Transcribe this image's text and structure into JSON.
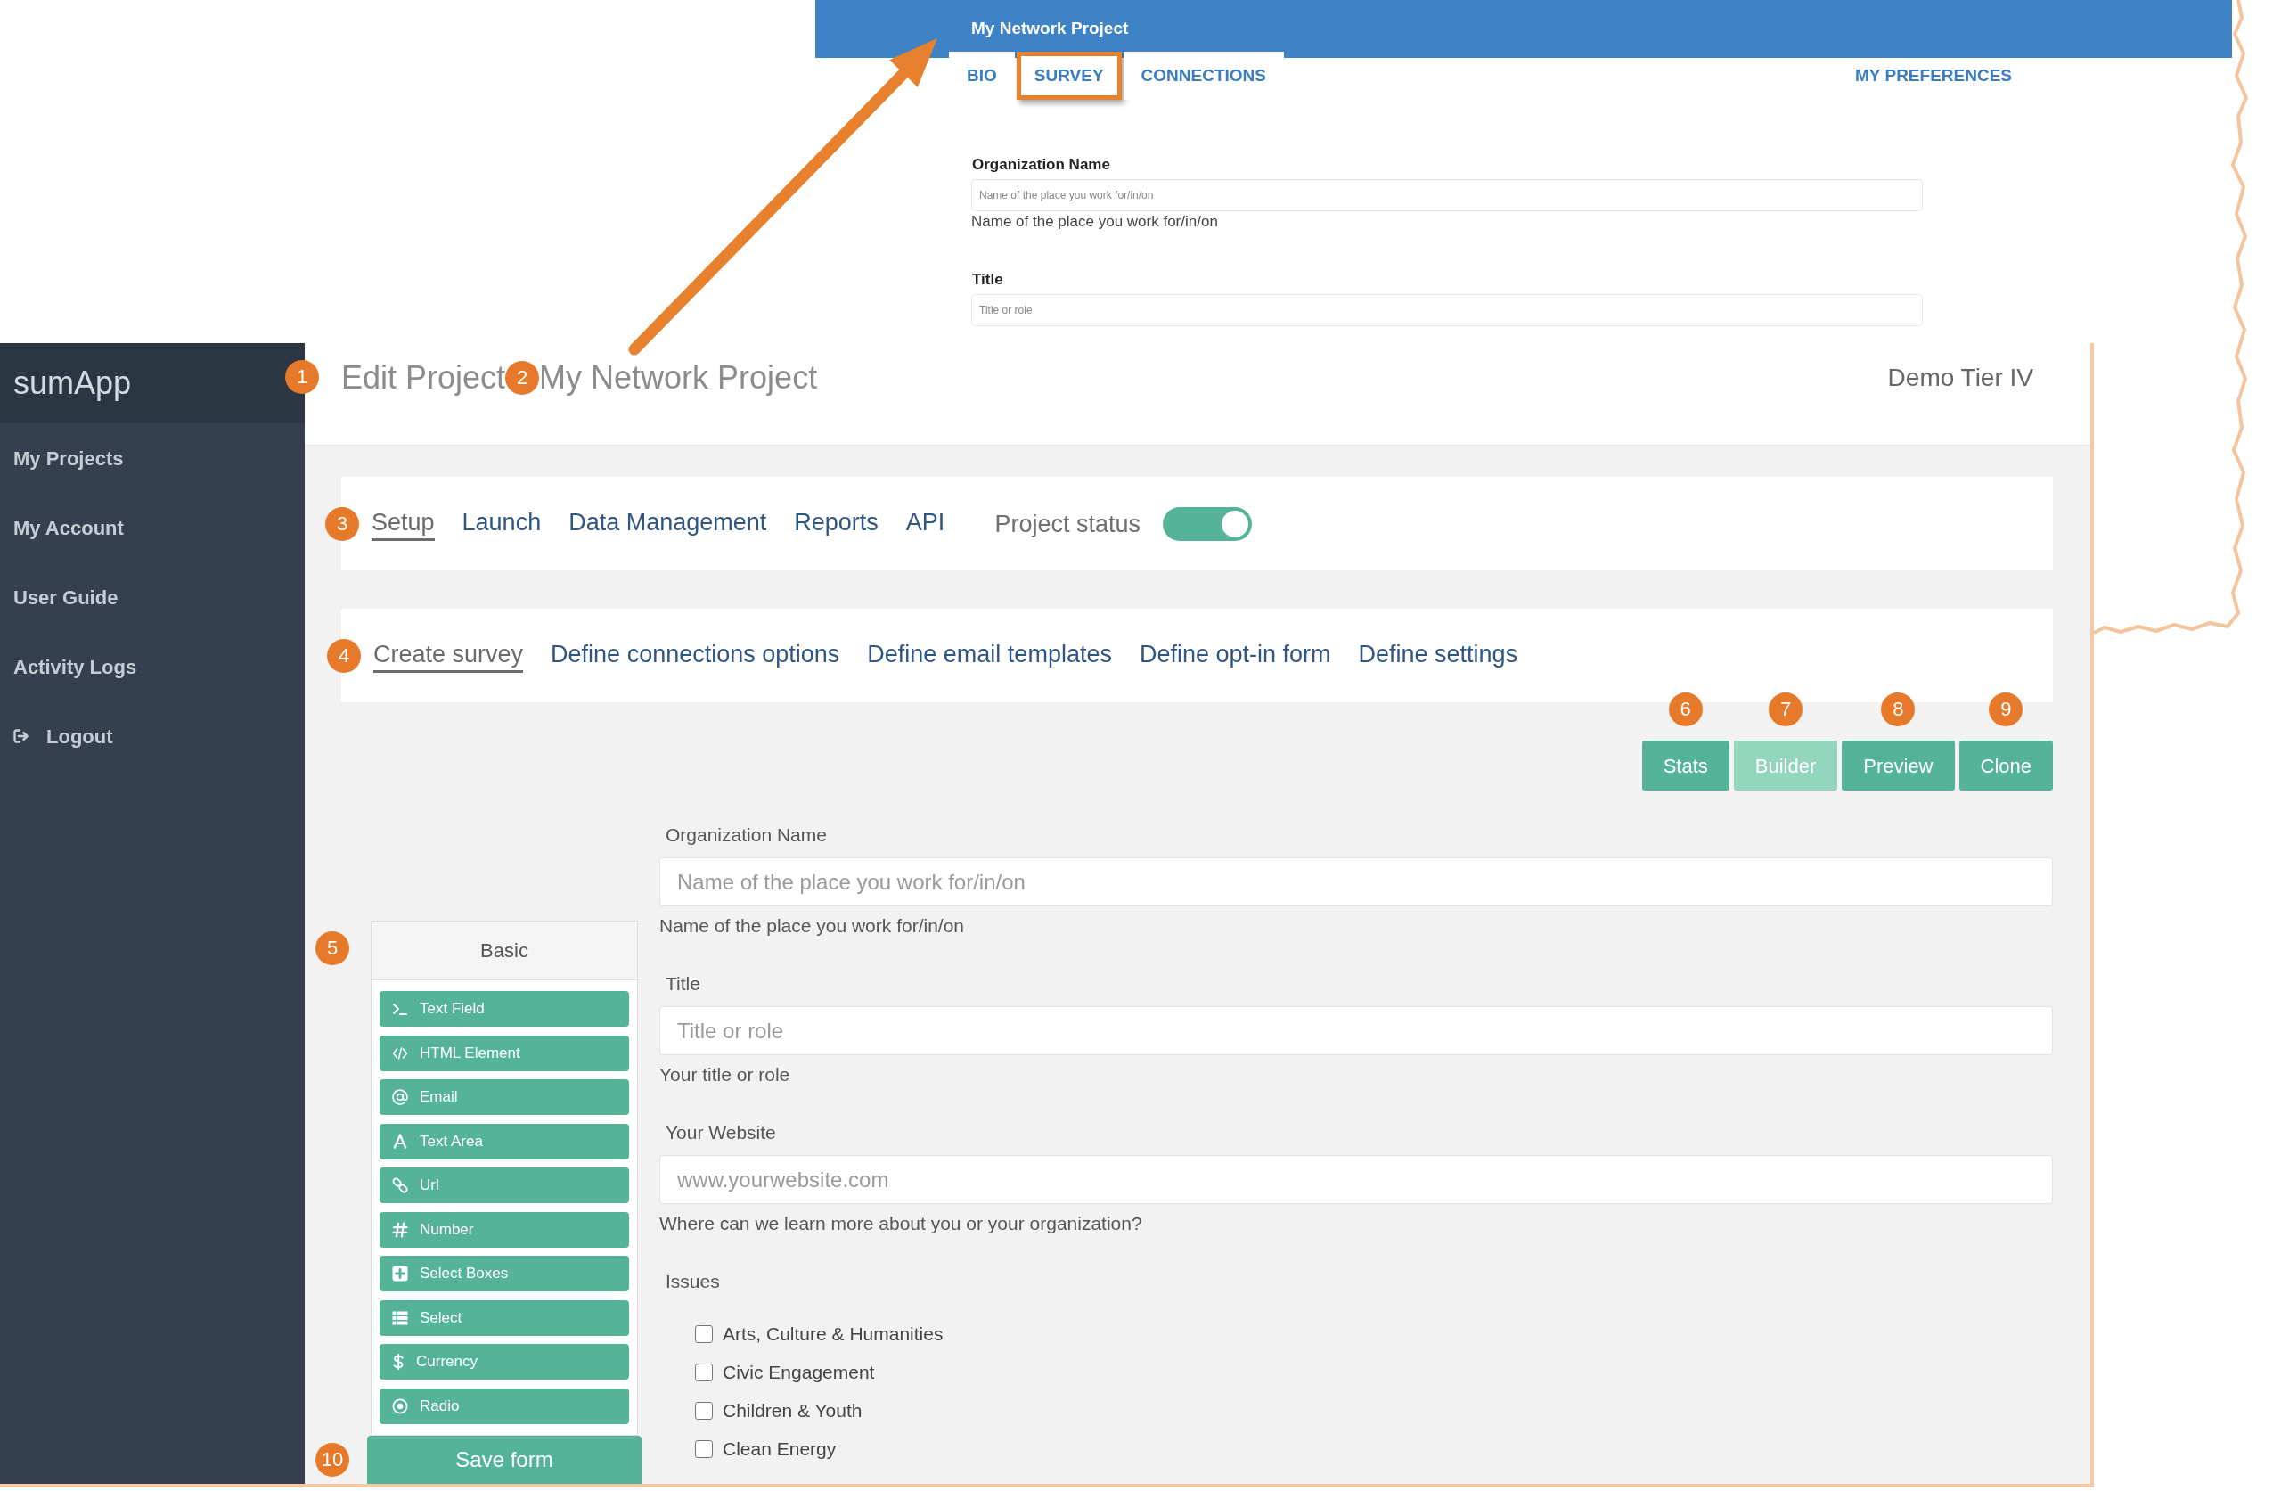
{
  "preview": {
    "title": "My Network Project",
    "tabs": [
      {
        "label": "BIO",
        "highlighted": false
      },
      {
        "label": "SURVEY",
        "highlighted": true
      },
      {
        "label": "CONNECTIONS",
        "highlighted": false
      }
    ],
    "preferences": "MY PREFERENCES",
    "fields": [
      {
        "label": "Organization Name",
        "placeholder": "Name of the place you work for/in/on",
        "help": "Name of the place you work for/in/on"
      },
      {
        "label": "Title",
        "placeholder": "Title or role"
      }
    ]
  },
  "app": {
    "logo": "sumApp",
    "sidebar": {
      "items": [
        {
          "label": "My Projects"
        },
        {
          "label": "My Account"
        },
        {
          "label": "User Guide"
        },
        {
          "label": "Activity Logs"
        }
      ],
      "logout": "Logout"
    },
    "header": {
      "callout": "1",
      "title": "Edit Project",
      "project_callout": "2",
      "project": "My Network Project",
      "tier": "Demo Tier IV"
    },
    "nav": {
      "callout": "3",
      "tabs": [
        {
          "label": "Setup",
          "selected": true
        },
        {
          "label": "Launch",
          "selected": false
        },
        {
          "label": "Data Management",
          "selected": false
        },
        {
          "label": "Reports",
          "selected": false
        },
        {
          "label": "API",
          "selected": false
        }
      ],
      "project_status": {
        "label": "Project status",
        "on": true
      }
    },
    "subnav": {
      "callout": "4",
      "tabs": [
        {
          "label": "Create survey",
          "selected": true
        },
        {
          "label": "Define connections options",
          "selected": false
        },
        {
          "label": "Define email templates",
          "selected": false
        },
        {
          "label": "Define opt-in form",
          "selected": false
        },
        {
          "label": "Define settings",
          "selected": false
        }
      ]
    },
    "actions": [
      {
        "callout": "6",
        "label": "Stats",
        "selected": false
      },
      {
        "callout": "7",
        "label": "Builder",
        "selected": true
      },
      {
        "callout": "8",
        "label": "Preview",
        "selected": false
      },
      {
        "callout": "9",
        "label": "Clone",
        "selected": false
      }
    ],
    "palette": {
      "callout": "5",
      "title": "Basic",
      "items": [
        {
          "label": "Text Field",
          "kind": "textfield"
        },
        {
          "label": "HTML Element",
          "kind": "html"
        },
        {
          "label": "Email",
          "kind": "email"
        },
        {
          "label": "Text Area",
          "kind": "textarea"
        },
        {
          "label": "Url",
          "kind": "url"
        },
        {
          "label": "Number",
          "kind": "number"
        },
        {
          "label": "Select Boxes",
          "kind": "selectboxes"
        },
        {
          "label": "Select",
          "kind": "select"
        },
        {
          "label": "Currency",
          "kind": "currency"
        },
        {
          "label": "Radio",
          "kind": "radio"
        }
      ]
    },
    "save": {
      "callout": "10",
      "label": "Save form"
    },
    "form": {
      "fields": [
        {
          "label": "Organization Name",
          "placeholder": "Name of the place you work for/in/on",
          "help": "Name of the place you work for/in/on"
        },
        {
          "label": "Title",
          "placeholder": "Title or role",
          "help": "Your title or role"
        },
        {
          "label": "Your Website",
          "placeholder": "www.yourwebsite.com",
          "help": "Where can we learn more about you or your organization?"
        }
      ],
      "issues": {
        "label": "Issues",
        "options": [
          {
            "label": "Arts, Culture & Humanities",
            "checked": false
          },
          {
            "label": "Civic Engagement",
            "checked": false
          },
          {
            "label": "Children & Youth",
            "checked": false
          },
          {
            "label": "Clean Energy",
            "checked": false
          }
        ]
      }
    }
  }
}
